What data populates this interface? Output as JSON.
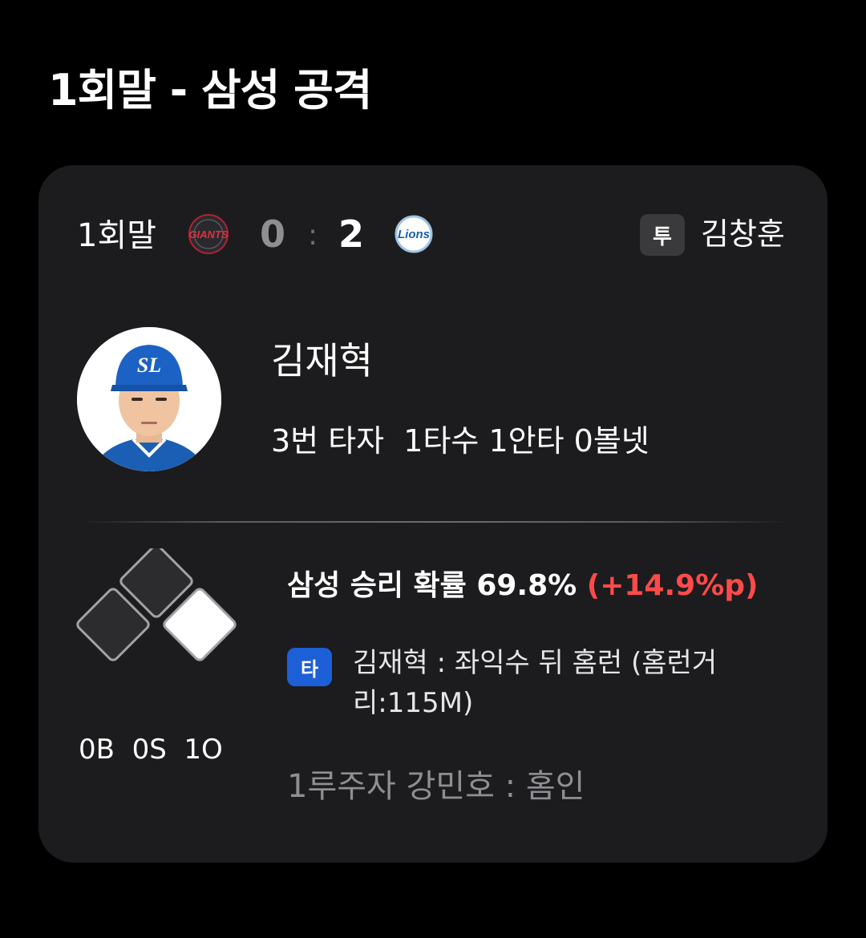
{
  "section": {
    "title": "1회말 - 삼성 공격"
  },
  "scoreboard": {
    "inning": "1회말",
    "away": {
      "team_logo_icon": "giants-logo-icon",
      "logo_text": "Giants",
      "score": "0"
    },
    "separator": ":",
    "home": {
      "team_logo_icon": "lions-logo-icon",
      "logo_text": "Lions",
      "score": "2"
    },
    "pitcher_badge": "투",
    "pitcher_name": "김창훈"
  },
  "batter": {
    "avatar_icon": "player-avatar-icon",
    "name": "김재혁",
    "stats": "3번 타자  1타수 1안타 0볼넷"
  },
  "situation": {
    "bases": {
      "first": false,
      "second": false,
      "third": false,
      "home_highlight": true
    },
    "count": "0B  0S  1O"
  },
  "event": {
    "win_prob_text": "삼성 승리 확률 69.8% ",
    "win_prob_delta": "(+14.9%p)",
    "play_badge": "타",
    "play_text": "김재혁 : 좌익수 뒤 홈런 (홈런거리:115M)",
    "runner_text": "1루주자 강민호 : 홈인"
  },
  "colors": {
    "background": "#000000",
    "card": "#1c1c1e",
    "delta_red": "#ff4a4a",
    "badge_blue": "#1d5fd6",
    "muted": "#8e8e93"
  }
}
